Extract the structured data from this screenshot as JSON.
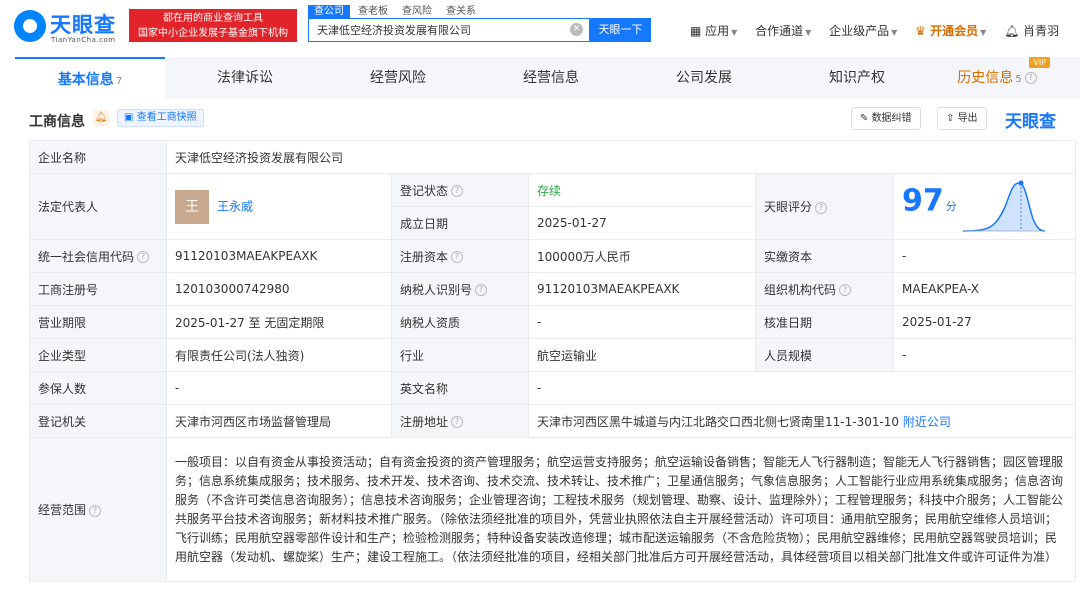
{
  "brand": {
    "name": "天眼查",
    "domain": "TianYanCha.com",
    "banner_line1": "都在用的商业查询工具",
    "banner_line2": "国家中小企业发展子基金旗下机构"
  },
  "search": {
    "tabs": [
      "查公司",
      "查老板",
      "查风险",
      "查关系"
    ],
    "value": "天津低空经济投资发展有限公司",
    "button": "天眼一下"
  },
  "topnav": {
    "items": [
      "应用",
      "合作通道",
      "企业级产品"
    ],
    "vip": "开通会员",
    "user": "肖青羽"
  },
  "tabs": [
    {
      "label": "基本信息",
      "count": "7"
    },
    {
      "label": "法律诉讼"
    },
    {
      "label": "经营风险"
    },
    {
      "label": "经营信息"
    },
    {
      "label": "公司发展"
    },
    {
      "label": "知识产权"
    },
    {
      "label": "历史信息",
      "count": "5",
      "badge": "VIP"
    }
  ],
  "section": {
    "title": "工商信息",
    "snapshot": "查看工商快照",
    "correct": "数据纠错",
    "export": "导出",
    "brand": "天眼查"
  },
  "info": {
    "company_name_label": "企业名称",
    "company_name": "天津低空经济投资发展有限公司",
    "legal_rep_label": "法定代表人",
    "legal_rep_avatar": "王",
    "legal_rep": "王永威",
    "status_label": "登记状态",
    "status": "存续",
    "founded_label": "成立日期",
    "founded": "2025-01-27",
    "score_label": "天眼评分",
    "score": "97",
    "score_unit": "分",
    "credit_code_label": "统一社会信用代码",
    "credit_code": "91120103MAEAKPEAXK",
    "reg_capital_label": "注册资本",
    "reg_capital": "100000万人民币",
    "paid_capital_label": "实缴资本",
    "paid_capital": "-",
    "reg_no_label": "工商注册号",
    "reg_no": "120103000742980",
    "tax_id_label": "纳税人识别号",
    "tax_id": "91120103MAEAKPEAXK",
    "org_code_label": "组织机构代码",
    "org_code": "MAEAKPEA-X",
    "term_label": "营业期限",
    "term": "2025-01-27 至 无固定期限",
    "taxpayer_label": "纳税人资质",
    "taxpayer": "-",
    "approve_label": "核准日期",
    "approve": "2025-01-27",
    "type_label": "企业类型",
    "type": "有限责任公司(法人独资)",
    "industry_label": "行业",
    "industry": "航空运输业",
    "staff_label": "人员规模",
    "staff": "-",
    "insured_label": "参保人数",
    "insured": "-",
    "en_name_label": "英文名称",
    "en_name": "-",
    "authority_label": "登记机关",
    "authority": "天津市河西区市场监督管理局",
    "address_label": "注册地址",
    "address": "天津市河西区黑牛城道与内江北路交口西北侧七贤南里11-1-301-10",
    "nearby": "附近公司",
    "scope_label": "经营范围",
    "scope": "一般项目：以自有资金从事投资活动；自有资金投资的资产管理服务；航空运营支持服务；航空运输设备销售；智能无人飞行器制造；智能无人飞行器销售；园区管理服务；信息系统集成服务；技术服务、技术开发、技术咨询、技术交流、技术转让、技术推广；卫星通信服务；气象信息服务；人工智能行业应用系统集成服务；信息咨询服务（不含许可类信息咨询服务）；信息技术咨询服务；企业管理咨询；工程技术服务（规划管理、勘察、设计、监理除外）；工程管理服务；科技中介服务；人工智能公共服务平台技术咨询服务；新材料技术推广服务。（除依法须经批准的项目外，凭营业执照依法自主开展经营活动）许可项目：通用航空服务；民用航空维修人员培训；飞行训练；民用航空器零部件设计和生产；检验检测服务；特种设备安装改造修理；城市配送运输服务（不含危险货物）；民用航空器维修；民用航空器驾驶员培训；民用航空器（发动机、螺旋桨）生产；建设工程施工。（依法须经批准的项目，经相关部门批准后方可开展经营活动，具体经营项目以相关部门批准文件或许可证件为准）"
  }
}
